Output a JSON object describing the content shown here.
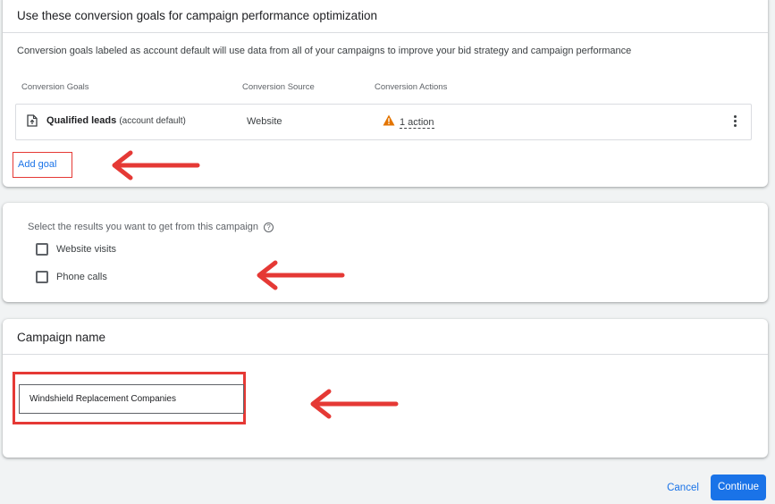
{
  "conversion_goals": {
    "title": "Use these conversion goals for campaign performance optimization",
    "description": "Conversion goals labeled as account default will use data from all of your campaigns to improve your bid strategy and campaign performance",
    "columns": [
      "Conversion Goals",
      "Conversion Source",
      "Conversion Actions"
    ],
    "goal": {
      "name": "Qualified leads",
      "suffix": "(account default)",
      "source": "Website",
      "actions": "1 action",
      "icon": "document-upload-icon",
      "warning_icon": "warning-triangle-icon"
    },
    "add_goal_label": "Add goal"
  },
  "results": {
    "label": "Select the results you want to get from this campaign",
    "help_icon": "help-circle-icon",
    "options": [
      {
        "label": "Website visits",
        "checked": false
      },
      {
        "label": "Phone calls",
        "checked": false
      }
    ]
  },
  "campaign_name": {
    "title": "Campaign name",
    "value": "Windshield Replacement Companies"
  },
  "footer": {
    "cancel_label": "Cancel",
    "continue_label": "Continue"
  },
  "colors": {
    "accent": "#1a73e8",
    "annotation_red": "#e53935",
    "warning": "#e37400"
  }
}
